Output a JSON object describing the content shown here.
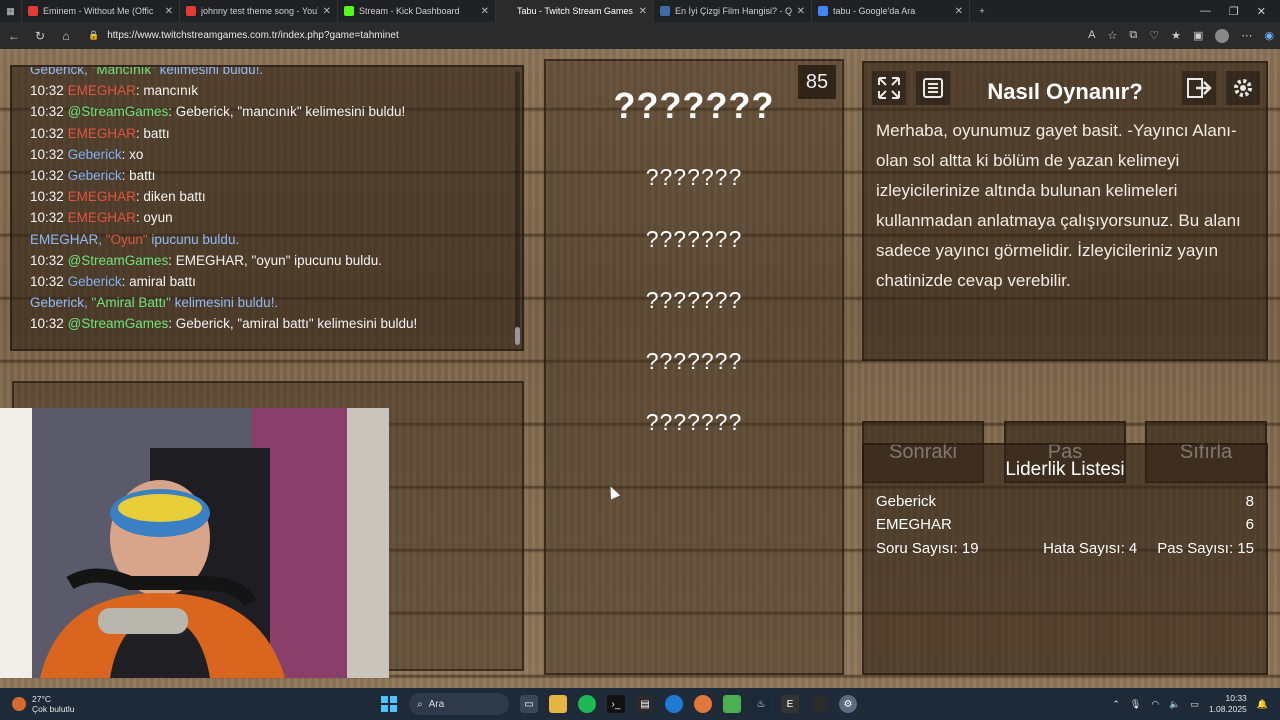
{
  "browser": {
    "tabs": [
      {
        "title": "Eminem - Without Me (Offic",
        "favicon_color": "#e53935",
        "active": false
      },
      {
        "title": "johnny test theme song - YouTub",
        "favicon_color": "#e53935",
        "active": false
      },
      {
        "title": "Stream - Kick Dashboard",
        "favicon_color": "#53fc18",
        "active": false
      },
      {
        "title": "Tabu - Twitch Stream Games",
        "favicon_color": "#2b2b2b",
        "active": true
      },
      {
        "title": "En İyi Çizgi Film Hangisi? - Quizei",
        "favicon_color": "#3a6ea5",
        "active": false
      },
      {
        "title": "tabu - Google'da Ara",
        "favicon_color": "#4285f4",
        "active": false
      }
    ],
    "url": "https://www.twitchstreamgames.com.tr/index.php?game=tahminet"
  },
  "chat": {
    "lines": [
      {
        "kind": "sys",
        "parts": [
          {
            "text": "Geberick, ",
            "c": "sys"
          },
          {
            "text": "\"Mancınık\"",
            "c": "hl-green"
          },
          {
            "text": " kelimesini buldu!.",
            "c": "sys"
          }
        ]
      },
      {
        "kind": "msg",
        "time": "10:32",
        "user": "EMEGHAR",
        "uc": "u-red",
        "text": ": mancınık"
      },
      {
        "kind": "msg",
        "time": "10:32",
        "user": "@StreamGames",
        "uc": "u-green",
        "text": ": Geberick, \"mancınık\" kelimesini buldu!"
      },
      {
        "kind": "msg",
        "time": "10:32",
        "user": "EMEGHAR",
        "uc": "u-red",
        "text": ": battı"
      },
      {
        "kind": "msg",
        "time": "10:32",
        "user": "Geberick",
        "uc": "u-blue",
        "text": ": xo"
      },
      {
        "kind": "msg",
        "time": "10:32",
        "user": "Geberick",
        "uc": "u-blue",
        "text": ": battı"
      },
      {
        "kind": "msg",
        "time": "10:32",
        "user": "EMEGHAR",
        "uc": "u-red",
        "text": ": diken battı"
      },
      {
        "kind": "msg",
        "time": "10:32",
        "user": "EMEGHAR",
        "uc": "u-red",
        "text": ": oyun"
      },
      {
        "kind": "sys",
        "parts": [
          {
            "text": "EMEGHAR, ",
            "c": "sys"
          },
          {
            "text": "\"Oyun\"",
            "c": "hl-red"
          },
          {
            "text": " ipucunu buldu.",
            "c": "sys"
          }
        ]
      },
      {
        "kind": "msg",
        "time": "10:32",
        "user": "@StreamGames",
        "uc": "u-green",
        "text": ": EMEGHAR, \"oyun\" ipucunu buldu."
      },
      {
        "kind": "msg",
        "time": "10:32",
        "user": "Geberick",
        "uc": "u-blue",
        "text": ": amiral battı"
      },
      {
        "kind": "sys",
        "parts": [
          {
            "text": "Geberick, ",
            "c": "sys"
          },
          {
            "text": "\"Amiral Battı\"",
            "c": "hl-green"
          },
          {
            "text": " kelimesini buldu!.",
            "c": "sys"
          }
        ]
      },
      {
        "kind": "msg",
        "time": "10:32",
        "user": "@StreamGames",
        "uc": "u-green",
        "text": ": Geberick, \"amiral battı\" kelimesini buldu!"
      }
    ]
  },
  "game": {
    "timer": "85",
    "main_word": "???????",
    "hints": [
      "???????",
      "???????",
      "???????",
      "???????",
      "???????"
    ]
  },
  "howto": {
    "title": "Nasıl Oynanır?",
    "text": "Merhaba, oyunumuz gayet basit. -Yayıncı Alanı- olan sol altta ki bölüm de yazan kelimeyi izleyicilerinize altında bulunan kelimeleri kullanmadan anlatmaya çalışıyorsunuz. Bu alanı sadece yayıncı görmelidir. İzleyicileriniz yayın chatinizde cevap verebilir."
  },
  "actions": {
    "next": "Sonraki",
    "pass": "Pas",
    "reset": "Sıfırla"
  },
  "leaderboard": {
    "title": "Liderlik Listesi",
    "rows": [
      {
        "name": "Geberick",
        "score": "8"
      },
      {
        "name": "EMEGHAR",
        "score": "6"
      }
    ],
    "questions": "Soru Sayısı: 19",
    "errors": "Hata Sayısı: 4",
    "passes": "Pas Sayısı: 15"
  },
  "taskbar": {
    "weather_temp": "27°C",
    "weather_desc": "Çok bulutlu",
    "search_placeholder": "Ara",
    "time": "10:33",
    "date": "1.08.2025"
  }
}
